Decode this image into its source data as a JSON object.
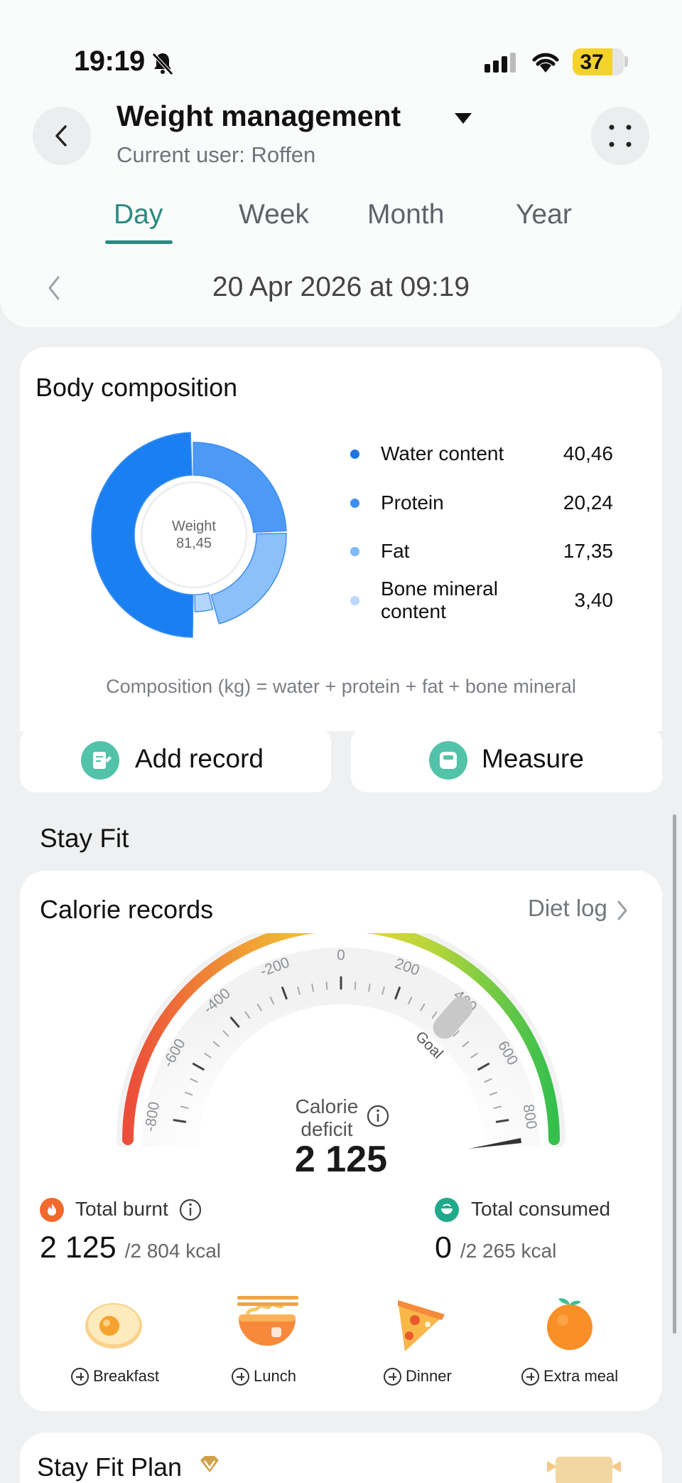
{
  "status_bar": {
    "time": "19:19",
    "battery": "37"
  },
  "header": {
    "title": "Weight management",
    "subtitle": "Current user: Roffen"
  },
  "tabs": [
    {
      "label": "Day",
      "active": true
    },
    {
      "label": "Week",
      "active": false
    },
    {
      "label": "Month",
      "active": false
    },
    {
      "label": "Year",
      "active": false
    }
  ],
  "date_nav": {
    "label": "20 Apr 2026 at 09:19"
  },
  "body_composition": {
    "title": "Body composition",
    "center_label": "Weight",
    "center_value": "81,45",
    "legend": [
      {
        "label": "Water content",
        "value": "40,46",
        "color": "#1f75e0"
      },
      {
        "label": "Protein",
        "value": "20,24",
        "color": "#3d8ef0"
      },
      {
        "label": "Fat",
        "value": "17,35",
        "color": "#7fb8fb"
      },
      {
        "label": "Bone mineral content",
        "value": "3,40",
        "color": "#b9d9ff"
      }
    ],
    "formula": "Composition (kg) = water + protein + fat + bone mineral"
  },
  "chart_data": {
    "type": "pie",
    "categories": [
      "Water content",
      "Protein",
      "Fat",
      "Bone mineral content"
    ],
    "values": [
      40.46,
      20.24,
      17.35,
      3.4
    ],
    "colors": [
      "#1a80f2",
      "#4c9af5",
      "#8cc0fa",
      "#b3d6fd"
    ]
  },
  "actions": {
    "add_record": "Add record",
    "measure": "Measure"
  },
  "stay_fit": {
    "section_title": "Stay Fit"
  },
  "calorie_records": {
    "title": "Calorie records",
    "diet_log": "Diet log",
    "gauge_ticks": [
      "-800",
      "-600",
      "-400",
      "-200",
      "0",
      "200",
      "400",
      "600",
      "800"
    ],
    "goal_label": "Goal",
    "center_label_1": "Calorie",
    "center_label_2": "deficit",
    "deficit_value": "2 125",
    "total_burnt_label": "Total burnt",
    "total_burnt_value": "2 125",
    "total_burnt_target": "/2 804 kcal",
    "total_consumed_label": "Total consumed",
    "total_consumed_value": "0",
    "total_consumed_target": "/2 265 kcal",
    "meals": [
      "Breakfast",
      "Lunch",
      "Dinner",
      "Extra meal"
    ]
  },
  "stay_fit_plan": {
    "title": "Stay Fit Plan"
  }
}
